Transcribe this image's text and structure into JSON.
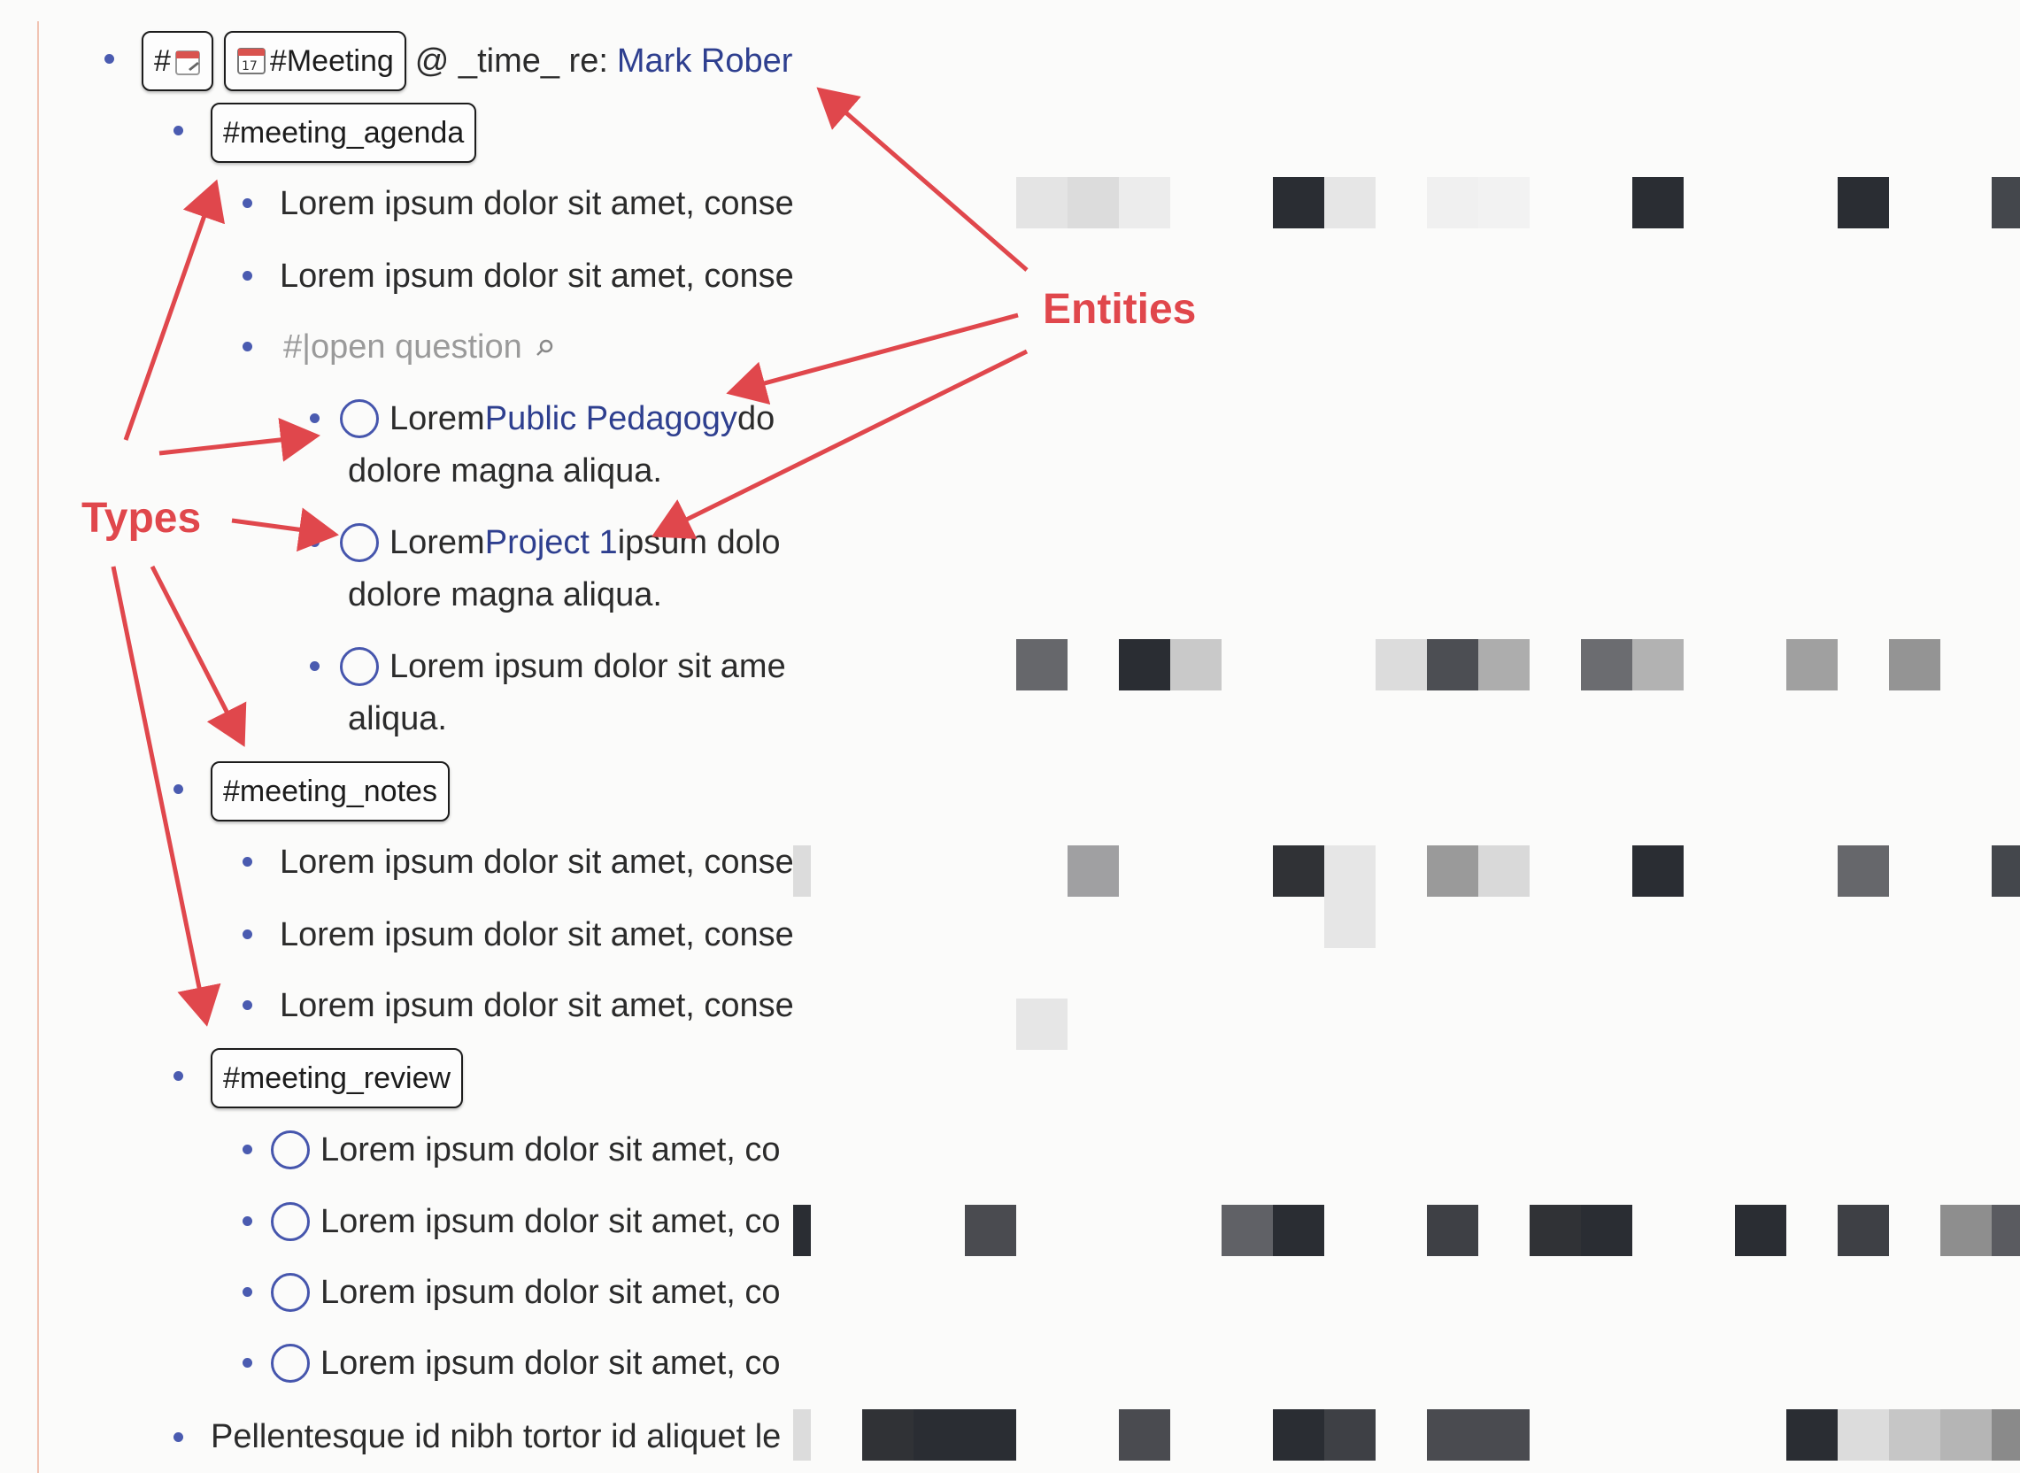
{
  "meeting": {
    "hash_icon_label": "#",
    "meeting_tag": "#Meeting",
    "calendar_day": "17",
    "line_text": "@ _time_ re:",
    "person_entity": "Mark Robertson"
  },
  "agenda": {
    "tag": "#meeting_agenda",
    "items": [
      "Lorem ipsum dolor sit amet, conse",
      "Lorem ipsum dolor sit amet, conse"
    ],
    "open_question": "#|open question",
    "open_question_icon": "search-icon",
    "tasks": [
      {
        "prefix": "Lorem ",
        "entity": "Public Pedagogy",
        "suffix": " do",
        "continuation": "dolore magna aliqua."
      },
      {
        "prefix": "Lorem ",
        "entity": "Project 1",
        "suffix": " ipsum dolo",
        "continuation": "dolore magna aliqua."
      },
      {
        "prefix": "Lorem ipsum dolor sit ame",
        "entity": "",
        "suffix": "",
        "continuation": "aliqua."
      }
    ]
  },
  "notes": {
    "tag": "#meeting_notes",
    "items": [
      "Lorem ipsum dolor sit amet, conse",
      "Lorem ipsum dolor sit amet, conse",
      "Lorem ipsum dolor sit amet, conse"
    ]
  },
  "review": {
    "tag": "#meeting_review",
    "tasks": [
      "Lorem ipsum dolor sit amet, co",
      "Lorem ipsum dolor sit amet, co",
      "Lorem ipsum dolor sit amet, co",
      "Lorem ipsum dolor sit amet, co"
    ]
  },
  "last_item": "Pellentesque id nibh tortor id aliquet le",
  "annotations": {
    "entities_label": "Entities",
    "types_label": "Types",
    "color": "#e0474c"
  },
  "colors": {
    "bullet": "#4a5bb0",
    "entity": "#2e3f8f",
    "task_circle": "#4656ad"
  }
}
